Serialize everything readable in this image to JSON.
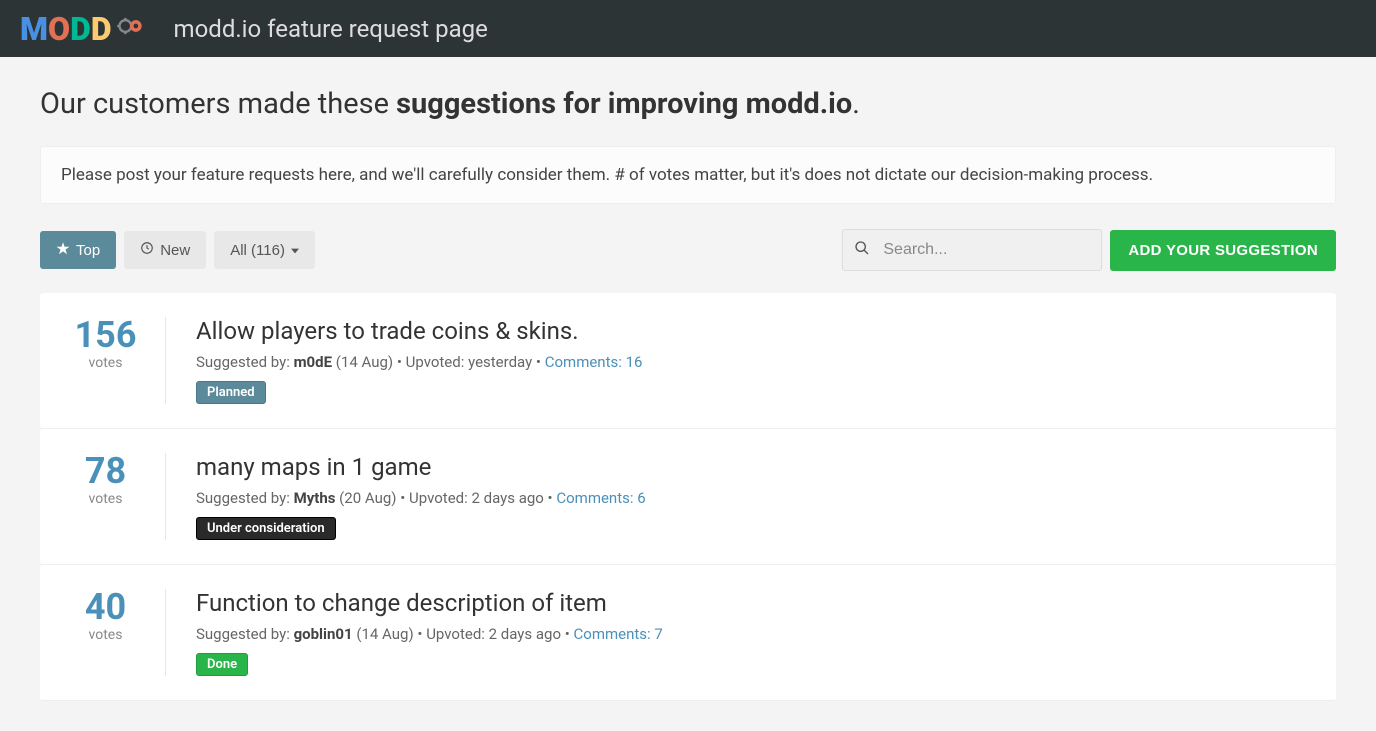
{
  "topbar": {
    "title": "modd.io feature request page"
  },
  "headline": {
    "prefix": "Our customers made these ",
    "bold": "suggestions for improving modd.io",
    "suffix": "."
  },
  "description": "Please post your feature requests here, and we'll carefully consider them. # of votes matter, but it's does not dictate our decision-making process.",
  "controls": {
    "top_label": "Top",
    "new_label": "New",
    "filter_label": "All (116)",
    "search_placeholder": "Search...",
    "add_label": "ADD YOUR SUGGESTION"
  },
  "suggestions": [
    {
      "votes": "156",
      "votes_label": "votes",
      "title": "Allow players to trade coins & skins.",
      "suggested_by_prefix": "Suggested by: ",
      "author": "m0dE",
      "date": " (14 Aug) ",
      "sep1": "• ",
      "upvoted": "Upvoted: yesterday ",
      "sep2": "• ",
      "comments": "Comments: 16",
      "status": "Planned",
      "status_class": "status-planned"
    },
    {
      "votes": "78",
      "votes_label": "votes",
      "title": "many maps in 1 game",
      "suggested_by_prefix": "Suggested by: ",
      "author": "Myths",
      "date": " (20 Aug) ",
      "sep1": "• ",
      "upvoted": "Upvoted: 2 days ago ",
      "sep2": "• ",
      "comments": "Comments: 6",
      "status": "Under consideration",
      "status_class": "status-under"
    },
    {
      "votes": "40",
      "votes_label": "votes",
      "title": "Function to change description of item",
      "suggested_by_prefix": "Suggested by: ",
      "author": "goblin01",
      "date": " (14 Aug) ",
      "sep1": "• ",
      "upvoted": "Upvoted: 2 days ago ",
      "sep2": "• ",
      "comments": "Comments: 7",
      "status": "Done",
      "status_class": "status-done"
    }
  ]
}
